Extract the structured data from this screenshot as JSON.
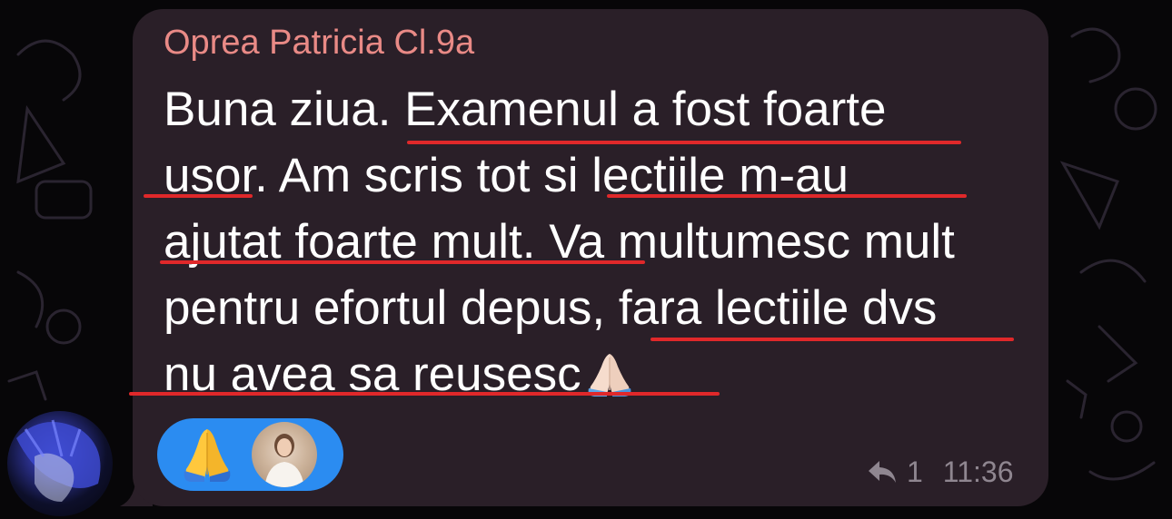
{
  "message": {
    "sender": "Oprea Patricia Cl.9a",
    "lines": [
      "Buna ziua. Examenul a fost foarte",
      "usor. Am scris tot si lectiile m-au",
      "ajutat foarte mult. Va multumesc mult",
      "pentru efortul depus, fara lectiile dvs",
      "nu avea sa reusesc"
    ],
    "trailing_emoji": "folded-hands-emoji",
    "reply_count": "1",
    "time": "11:36"
  },
  "reactions": [
    {
      "emoji": "folded-hands-emoji",
      "reactor": "reactor-avatar"
    }
  ],
  "colors": {
    "background": "#070608",
    "bubble": "#2a1f28",
    "sender_name": "#e98a86",
    "message_text": "#ffffff",
    "meta_text": "#8f8690",
    "reaction_pill": "#2b8cf1",
    "underline_annotation": "#e0282a"
  }
}
